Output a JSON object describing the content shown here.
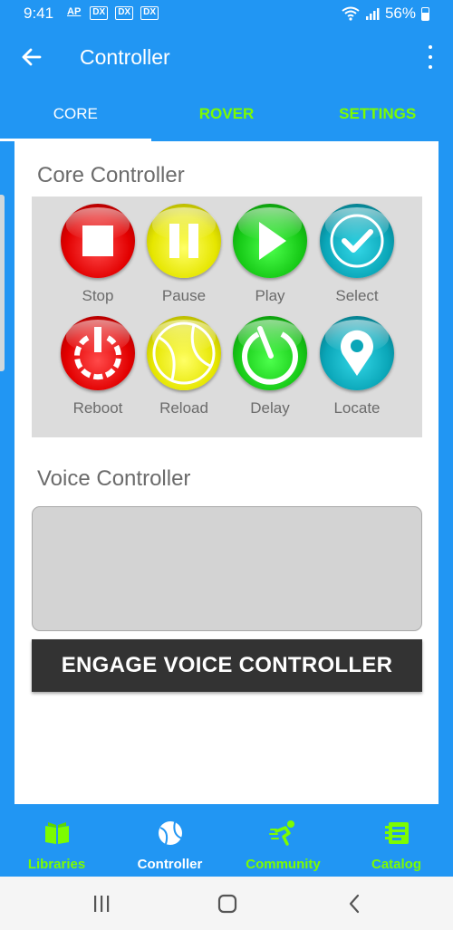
{
  "status_bar": {
    "time": "9:41",
    "notification_icons": [
      "AP",
      "DX",
      "DX",
      "DX"
    ],
    "battery": "56%"
  },
  "app_bar": {
    "title": "Controller",
    "back_icon": "arrow-left-icon",
    "menu_icon": "more-vertical-icon"
  },
  "tabs": [
    {
      "label": "CORE",
      "active": true
    },
    {
      "label": "ROVER",
      "active": false
    },
    {
      "label": "SETTINGS",
      "active": false
    }
  ],
  "core_controller": {
    "title": "Core Controller",
    "buttons": [
      {
        "label": "Stop",
        "icon": "stop-icon",
        "color": "#e20000"
      },
      {
        "label": "Pause",
        "icon": "pause-icon",
        "color": "#e6e600"
      },
      {
        "label": "Play",
        "icon": "play-icon",
        "color": "#16c916"
      },
      {
        "label": "Select",
        "icon": "check-icon",
        "color": "#0aa6b8"
      },
      {
        "label": "Reboot",
        "icon": "power-icon",
        "color": "#e20000"
      },
      {
        "label": "Reload",
        "icon": "tennis-ball-icon",
        "color": "#e6e600"
      },
      {
        "label": "Delay",
        "icon": "timer-icon",
        "color": "#16c916"
      },
      {
        "label": "Locate",
        "icon": "map-pin-icon",
        "color": "#0aa6b8"
      }
    ]
  },
  "voice_controller": {
    "title": "Voice Controller",
    "transcript": "",
    "engage_label": "ENGAGE VOICE CONTROLLER"
  },
  "bottom_nav": [
    {
      "label": "Libraries",
      "icon": "book-icon",
      "active": false
    },
    {
      "label": "Controller",
      "icon": "ball-icon",
      "active": true
    },
    {
      "label": "Community",
      "icon": "runner-icon",
      "active": false
    },
    {
      "label": "Catalog",
      "icon": "catalog-icon",
      "active": false
    }
  ],
  "colors": {
    "primary": "#2196f3",
    "accent_green": "#7cfc00",
    "panel_gray": "#dcdcdc",
    "engage_button": "#333333"
  }
}
